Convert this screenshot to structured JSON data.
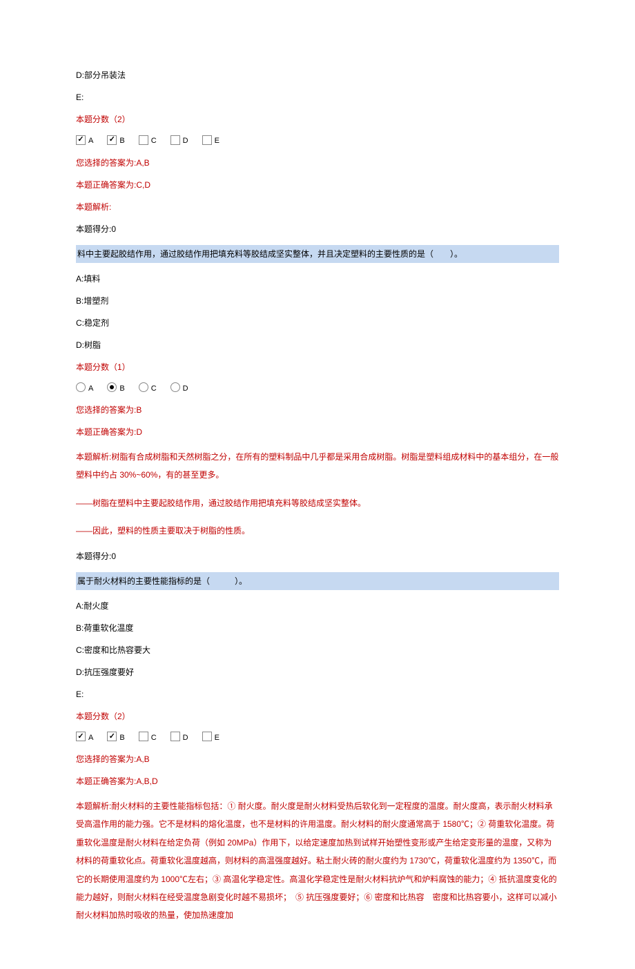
{
  "q1": {
    "option_d": "D:部分吊装法",
    "option_e": "E:",
    "points_label": "本题分数（2）",
    "answers": [
      "A",
      "B",
      "C",
      "D",
      "E"
    ],
    "selected_label": "您选择的答案为:A,B",
    "correct_label": "本题正确答案为:C,D",
    "explanation_label": "本题解析:",
    "score_label": "本题得分:0"
  },
  "q2": {
    "question": "料中主要起胶结作用，通过胶结作用把填充料等胶结成坚实整体，并且决定塑料的主要性质的是（　　）。",
    "option_a": "A:填料",
    "option_b": "B:增塑剂",
    "option_c": "C:稳定剂",
    "option_d": "D:树脂",
    "points_label": "本题分数（1）",
    "answers": [
      "A",
      "B",
      "C",
      "D"
    ],
    "selected_label": "您选择的答案为:B",
    "correct_label": "本题正确答案为:D",
    "explanation_prefix": "本题解析:",
    "explanation": "树脂有合成树脂和天然树脂之分，在所有的塑料制品中几乎都是采用合成树脂。树脂是塑料组成材料中的基本组分，在一般塑料中约占 30%~60%，有的甚至更多。",
    "explanation_line2": "——树脂在塑料中主要起胶结作用，通过胶结作用把填充料等胶结成坚实整体。",
    "explanation_line3": "——因此，塑料的性质主要取决于树脂的性质。",
    "score_label": "本题得分:0"
  },
  "q3": {
    "question": "属于耐火材料的主要性能指标的是（　　　）。",
    "option_a": "A:耐火度",
    "option_b": "B:荷重软化温度",
    "option_c": "C:密度和比热容要大",
    "option_d": "D:抗压强度要好",
    "option_e": "E:",
    "points_label": "本题分数（2）",
    "answers": [
      "A",
      "B",
      "C",
      "D",
      "E"
    ],
    "selected_label": "您选择的答案为:A,B",
    "correct_label": "本题正确答案为:A,B,D",
    "explanation_prefix": "本题解析:",
    "explanation": "耐火材料的主要性能指标包括：① 耐火度。耐火度是耐火材料受热后软化到一定程度的温度。耐火度高，表示耐火材料承受高温作用的能力强。它不是材料的熔化温度，也不是材料的许用温度。耐火材料的耐火度通常高于 1580℃；② 荷重软化温度。荷重软化温度是耐火材料在给定负荷（例如 20MPa）作用下，以给定速度加热到试样开始塑性变形或产生给定变形量的温度，又称为材料的荷重软化点。荷重软化温度越高，则材料的高温强度越好。粘土耐火砖的耐火度约为 1730℃，荷重软化温度约为 1350℃，而它的长期使用温度约为 1000℃左右；③ 高温化学稳定性。高温化学稳定性是耐火材料抗炉气和炉料腐蚀的能力；④ 抵抗温度变化的能力越好，则耐火材料在经受温度急剧变化时越不易损坏；　⑤ 抗压强度要好；⑥ 密度和比热容　密度和比热容要小，这样可以减小耐火材料加热时吸收的热量，使加热速度加"
  }
}
